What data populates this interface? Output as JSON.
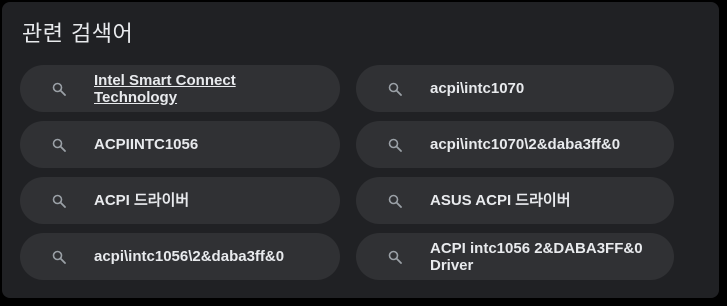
{
  "section": {
    "title": "관련 검색어"
  },
  "searches": [
    {
      "text": "Intel Smart Connect Technology",
      "underlined": true
    },
    {
      "text": "acpi\\intc1070",
      "underlined": false
    },
    {
      "text": "ACPIINTC1056",
      "underlined": false
    },
    {
      "text": "acpi\\intc1070\\2&daba3ff&0",
      "underlined": false
    },
    {
      "text": "ACPI 드라이버",
      "underlined": false
    },
    {
      "text": "ASUS ACPI 드라이버",
      "underlined": false
    },
    {
      "text": "acpi\\intc1056\\2&daba3ff&0",
      "underlined": false
    },
    {
      "text": "ACPI intc1056 2&DABA3FF&0 Driver",
      "underlined": false
    }
  ],
  "icons": {
    "chip_icon": "search-icon"
  },
  "colors": {
    "panel_bg": "#202124",
    "chip_bg": "#303134",
    "text": "#e8eaed",
    "icon": "#9aa0a6"
  }
}
